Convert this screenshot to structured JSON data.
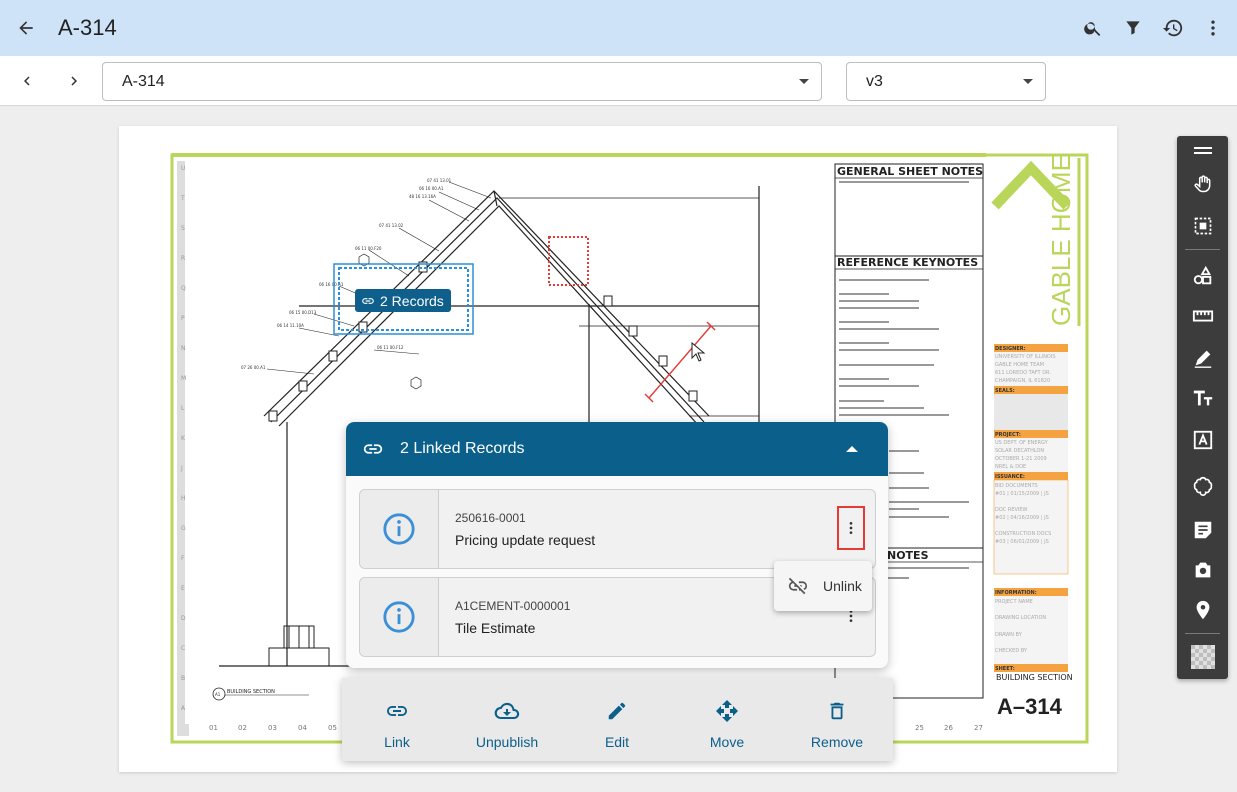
{
  "appbar": {
    "title": "A-314",
    "icons": [
      "back-arrow-icon",
      "search-icon",
      "filter-icon",
      "history-icon",
      "more-vert-icon"
    ]
  },
  "toolbar": {
    "sheet_select": "A-314",
    "version_select": "v3"
  },
  "drawing": {
    "record_marker": "2 Records",
    "general_notes_title": "GENERAL SHEET NOTES",
    "reference_keynotes_title": "REFERENCE KEYNOTES",
    "notes_title": "NOTES",
    "brand_text": "GABLE HOME",
    "sheet_title": "BUILDING SECTION",
    "sheet_number": "A–314",
    "section_label": "BUILDING SECTION",
    "section_number": "A1",
    "grid_numbers_left": [
      "01",
      "02",
      "03",
      "04",
      "05"
    ],
    "grid_numbers_right": [
      "25",
      "26",
      "27"
    ],
    "title_block": {
      "designer_label": "DESIGNER:",
      "designer_lines": [
        "UNIVERSITY OF ILLINOIS",
        "GABLE HOME TEAM",
        "611 LOREDO TAFT DR.",
        "CHAMPAIGN, IL 61820"
      ],
      "seals_label": "SEALS:",
      "project_label": "PROJECT:",
      "project_lines": [
        "US DEPT. OF ENERGY",
        "SOLAR DECATHLON",
        "OCTOBER 1-21 2009",
        "NREL & DOE"
      ],
      "issuance_label": "ISSUANCE:",
      "issuance_lines": [
        "BID DOCUMENTS",
        "#01 | 01/15/2009 | JS",
        "DOC REVIEW",
        "#02 | 04/16/2009 | JS",
        "CONSTRUCTION DOCS",
        "#03 | 06/01/2009 | JS"
      ],
      "information_label": "INFORMATION:",
      "information_lines": [
        "PROJECT NAME",
        "DRAWING LOCATION",
        "DRAWN BY",
        "CHECKED BY"
      ],
      "sheet_label": "SHEET:"
    }
  },
  "linked_panel": {
    "title": "2 Linked Records",
    "records": [
      {
        "id": "250616-0001",
        "name": "Pricing update request"
      },
      {
        "id": "A1CEMENT-0000001",
        "name": "Tile Estimate"
      }
    ]
  },
  "context_menu": {
    "unlink_label": "Unlink"
  },
  "actions": {
    "link": "Link",
    "unpublish": "Unpublish",
    "edit": "Edit",
    "move": "Move",
    "remove": "Remove"
  },
  "palette": {
    "tools": [
      "drag-handle-icon",
      "pan-hand-icon",
      "select-area-icon",
      "shapes-icon",
      "ruler-icon",
      "draw-icon",
      "text-size-icon",
      "text-box-icon",
      "cloud-icon",
      "note-icon",
      "camera-icon",
      "location-pin-icon",
      "transparency-icon"
    ]
  },
  "colors": {
    "appbar_bg": "#cfe3f8",
    "accent": "#0b5f8b",
    "highlight_red": "#e53935",
    "sheet_green": "#b9d65a",
    "titleblock_orange": "#f4a340"
  }
}
